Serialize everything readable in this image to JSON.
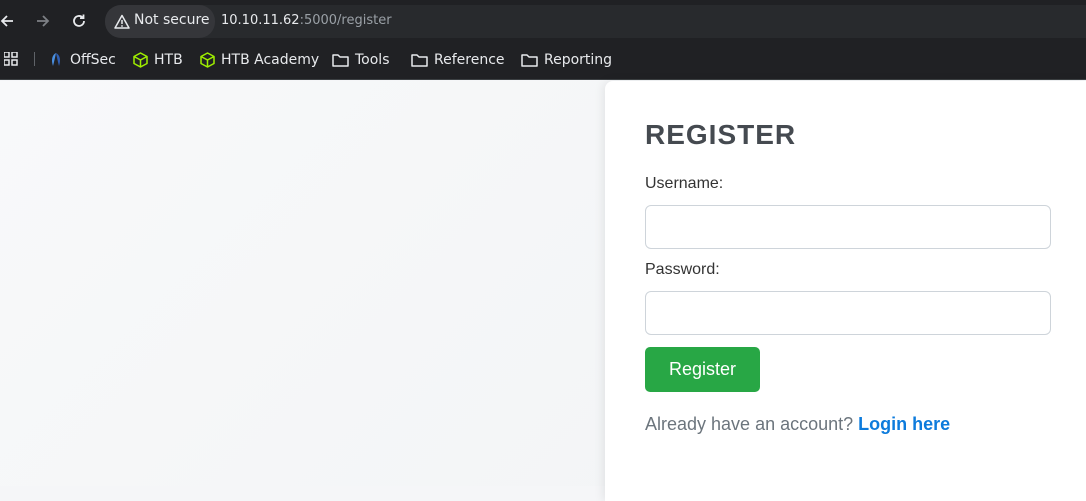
{
  "browser": {
    "security_label": "Not secure",
    "url_host": "10.10.11.62",
    "url_rest": ":5000/register",
    "icons": {
      "back": "back-arrow-icon",
      "forward": "forward-arrow-icon",
      "reload": "reload-icon",
      "security": "warning-triangle-icon",
      "apps": "apps-grid-icon"
    }
  },
  "bookmarks": [
    {
      "label": "OffSec",
      "icon": "offsec-icon"
    },
    {
      "label": "HTB",
      "icon": "htb-cube-icon"
    },
    {
      "label": "HTB Academy",
      "icon": "htb-cube-icon"
    },
    {
      "label": "Tools",
      "icon": "folder-icon"
    },
    {
      "label": "Reference",
      "icon": "folder-icon"
    },
    {
      "label": "Reporting",
      "icon": "folder-icon"
    }
  ],
  "form": {
    "title": "REGISTER",
    "username_label": "Username:",
    "username_value": "",
    "password_label": "Password:",
    "password_value": "",
    "submit_label": "Register",
    "footer_text": "Already have an account?",
    "login_link": "Login here"
  },
  "colors": {
    "chrome_bg": "#202124",
    "button_green": "#28a745",
    "link_blue": "#0d7bdc",
    "htb_green": "#9fef00"
  }
}
